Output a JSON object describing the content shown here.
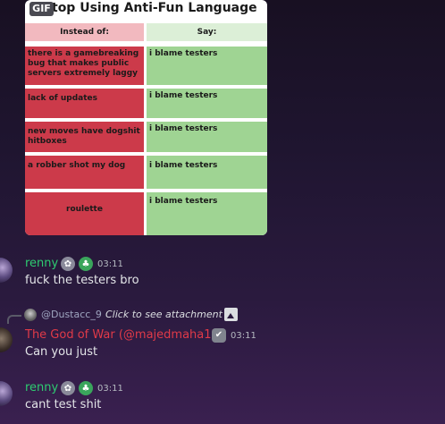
{
  "gif": {
    "badge": "GIF",
    "title": "top Using Anti-Fun Language",
    "headers": {
      "left": "Instead of:",
      "right": "Say:"
    },
    "rows": [
      {
        "left": "there is a gamebreaking bug that makes public servers extremely laggy",
        "right": "i blame testers"
      },
      {
        "left": "lack of updates",
        "right": "i blame testers"
      },
      {
        "left": "new moves have dogshit hitboxes",
        "right": "i blame testers"
      },
      {
        "left": "a robber shot my  dog",
        "right": "i blame testers"
      },
      {
        "left": "roulette",
        "right": "i blame testers"
      }
    ]
  },
  "messages": [
    {
      "username": "renny",
      "timestamp": "03:11",
      "text": "fuck the testers bro",
      "name_color": "#2ecc71"
    },
    {
      "username": "The God of War (@majedmaha12)",
      "timestamp": "03:11",
      "text": "Can you just",
      "name_color": "#e03a48",
      "reply": {
        "name": "@Dustacc_9",
        "attachment_text": "Click to see attachment"
      }
    },
    {
      "username": "renny",
      "timestamp": "03:11",
      "text": "cant test shit",
      "name_color": "#2ecc71"
    }
  ],
  "icons": {
    "role_icon_1": "paw-badge-icon",
    "role_icon_2": "leaf-badge-icon",
    "verified": "check-badge-icon",
    "attachment": "image-icon"
  }
}
